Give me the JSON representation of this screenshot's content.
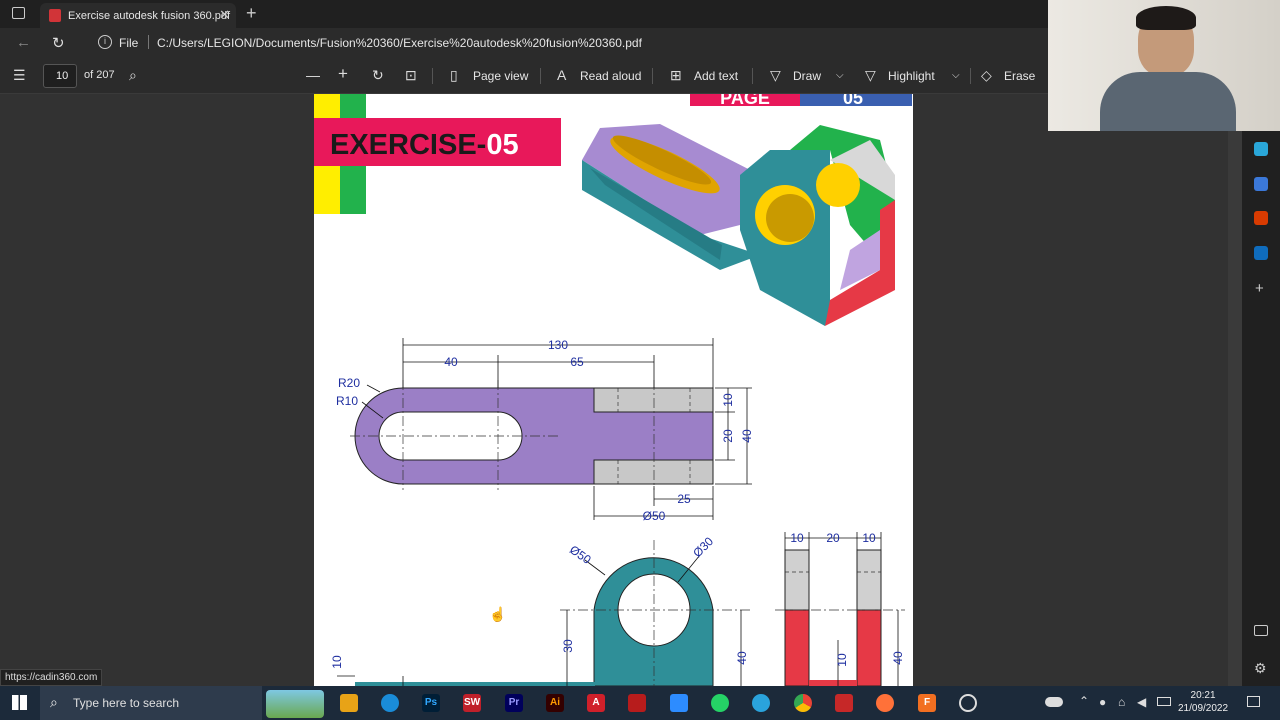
{
  "browser": {
    "tab_title": "Exercise autodesk fusion 360.pdf",
    "address_label": "File",
    "url": "C:/Users/LEGION/Documents/Fusion%20360/Exercise%20autodesk%20fusion%20360.pdf"
  },
  "pdf_toolbar": {
    "page_number": "10",
    "page_total": "of 207",
    "page_view": "Page view",
    "read_aloud": "Read aloud",
    "add_text": "Add text",
    "draw": "Draw",
    "highlight": "Highlight",
    "erase": "Erase"
  },
  "document": {
    "page_badge": "PAGE",
    "page_no": "05",
    "title_prefix": "EXERCISE-",
    "title_number": "05",
    "dims": {
      "d130": "130",
      "d40": "40",
      "d65": "65",
      "r20": "R20",
      "r10": "R10",
      "d10": "10",
      "d20": "20",
      "d40b": "40",
      "d25": "25",
      "phi50": "Ø50",
      "phi50b": "Ø50",
      "phi30": "Ø30",
      "d30": "30",
      "d40c": "40",
      "s10a": "10",
      "s20": "20",
      "s10b": "10",
      "s10c": "10",
      "s40": "40",
      "left10": "10"
    }
  },
  "status_link": "https://cadin360.com",
  "taskbar": {
    "search_placeholder": "Type here to search",
    "time": "20:21",
    "date": "21/09/2022"
  },
  "colors": {
    "purple": "#9b7fc6",
    "teal": "#2f8f98",
    "red": "#e63946",
    "green": "#22b24c",
    "yellow": "#ffee00",
    "magenta": "#e8185a",
    "dim_blue": "#1f2fa0"
  }
}
